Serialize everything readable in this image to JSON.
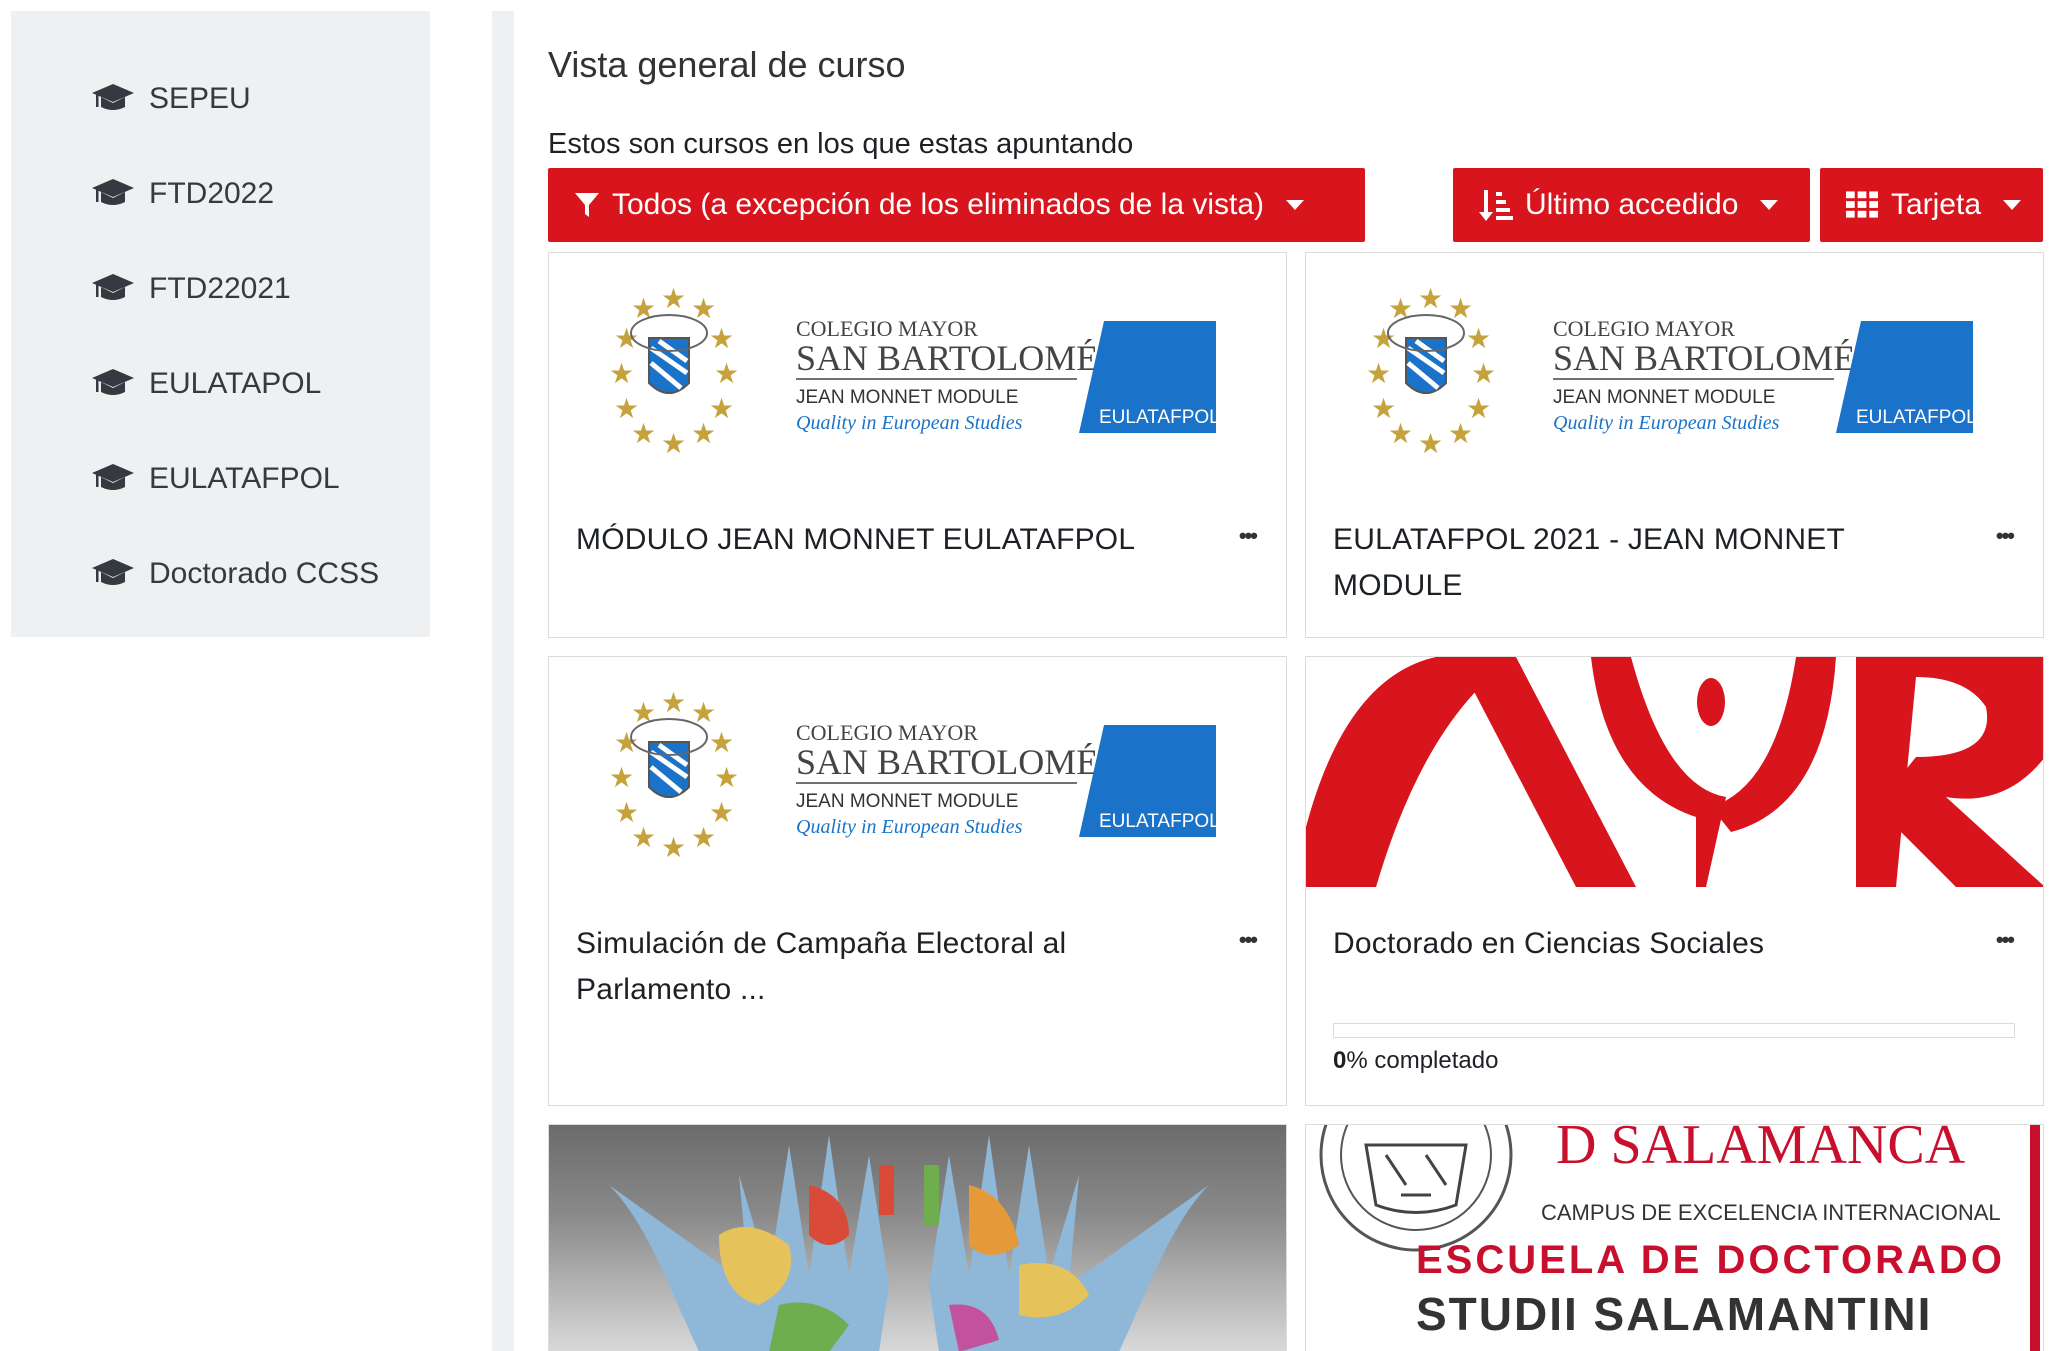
{
  "sidebar": {
    "items": [
      {
        "label": "SEPEU",
        "icon": "graduation-cap-icon"
      },
      {
        "label": "FTD2022",
        "icon": "graduation-cap-icon"
      },
      {
        "label": "FTD22021",
        "icon": "graduation-cap-icon"
      },
      {
        "label": "EULATAPOL",
        "icon": "graduation-cap-icon"
      },
      {
        "label": "EULATAFPOL",
        "icon": "graduation-cap-icon"
      },
      {
        "label": "Doctorado CCSS",
        "icon": "graduation-cap-icon"
      }
    ]
  },
  "main": {
    "title": "Vista general de curso",
    "subtitle": "Estos son cursos en los que estas apuntando",
    "filter_button": "Todos (a excepción de los eliminados de la vista)",
    "sort_button": "Último accedido",
    "view_button": "Tarjeta"
  },
  "logo": {
    "line1": "COLEGIO MAYOR",
    "line2": "SAN BARTOLOMÉ",
    "line3": "JEAN MONNET MODULE",
    "line4": "Quality in European Studies",
    "badge": "EULATAFPOL"
  },
  "courses": [
    {
      "title": "MÓDULO JEAN MONNET EULATAFPOL",
      "more": "•••"
    },
    {
      "title": "EULATAFPOL 2021 - JEAN MONNET MODULE",
      "more": "•••"
    },
    {
      "title": "Simulación de Campaña Electoral al Parlamento ...",
      "more": "•••"
    },
    {
      "title": "Doctorado en Ciencias Sociales",
      "more": "•••",
      "progress_value": "0",
      "progress_suffix": "% completado",
      "progress_percent": 0
    }
  ],
  "salamanca_banner": {
    "top": "D SALAMANCA",
    "line1": "CAMPUS DE EXCELENCIA INTERNACIONAL",
    "line2": "ESCUELA DE DOCTORADO",
    "line3": "STUDII SALAMANTINI"
  },
  "colors": {
    "accent_red": "#d8141c",
    "logo_blue": "#1a73c9",
    "logo_gold": "#c6a23d",
    "sidebar_bg": "#eff0f1"
  }
}
